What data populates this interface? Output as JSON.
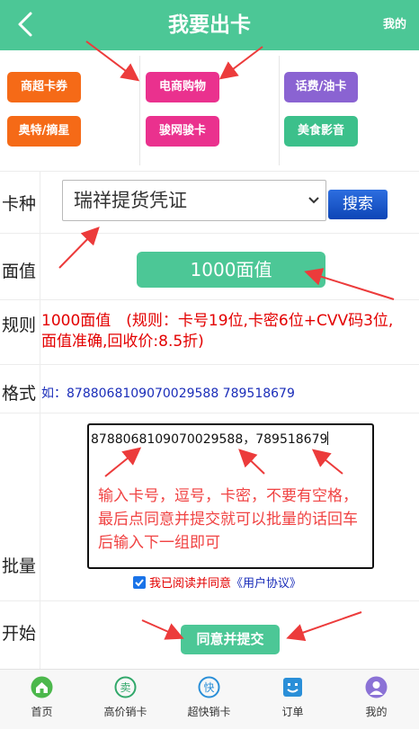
{
  "header": {
    "title": "我要出卡",
    "right_label": "我的",
    "back_icon": "chevron-left-icon",
    "bg_color": "#4cc796"
  },
  "categories": [
    {
      "label": "商超卡券",
      "color": "#f56a17"
    },
    {
      "label": "电商购物",
      "color": "#ea318e"
    },
    {
      "label": "话费/油卡",
      "color": "#8a63d2"
    },
    {
      "label": "奥特/摘星",
      "color": "#f56a17"
    },
    {
      "label": "骏网骏卡",
      "color": "#ea318e"
    },
    {
      "label": "美食影音",
      "color": "#3cc08b"
    }
  ],
  "form": {
    "card_type_label": "卡种",
    "card_type_value": "瑞祥提货凭证",
    "search_label": "搜索",
    "face_value_label": "面值",
    "face_value": "1000面值",
    "rule_label": "规则",
    "rule_text": "1000面值　(规则：卡号19位,卡密6位+CVV码3位,面值准确,回收价:8.5折)",
    "format_label": "格式",
    "format_text": "如：8788068109070029588 789518679",
    "batch_label": "批量",
    "batch_value": "8788068109070029588，789518679",
    "batch_hint": "输入卡号，逗号，卡密，不要有空格，最后点同意并提交就可以批量的话回车后输入下一组即可",
    "agree_checked": true,
    "agree_text": "我已阅读并同意",
    "agree_link": "《用户协议》",
    "start_label": "开始",
    "submit_label": "同意并提交"
  },
  "nav": [
    {
      "label": "首页",
      "icon": "home-icon",
      "color": "#4cb84c"
    },
    {
      "label": "高价销卡",
      "icon": "sell-card-icon",
      "color": "#31a86a",
      "active": true
    },
    {
      "label": "超快销卡",
      "icon": "fast-icon",
      "color": "#2a8fd8"
    },
    {
      "label": "订单",
      "icon": "order-icon",
      "color": "#2a8fd8"
    },
    {
      "label": "我的",
      "icon": "profile-icon",
      "color": "#8b72d6"
    }
  ]
}
